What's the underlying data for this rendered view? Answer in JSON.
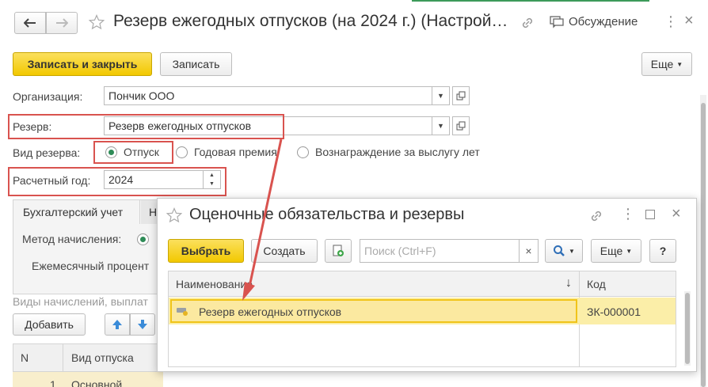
{
  "header": {
    "title": "Резерв ежегодных отпусков (на 2024 г.) (Настрой…",
    "discussion_label": "Обсуждение"
  },
  "toolbar": {
    "save_close_label": "Записать и закрыть",
    "save_label": "Записать",
    "more_label": "Еще"
  },
  "form": {
    "organization_label": "Организация:",
    "organization_value": "Пончик ООО",
    "reserve_label": "Резерв:",
    "reserve_value": "Резерв ежегодных отпусков",
    "reserve_type_label": "Вид резерва:",
    "reserve_type_options": [
      "Отпуск",
      "Годовая премия",
      "Вознаграждение за выслугу лет"
    ],
    "year_label": "Расчетный год:",
    "year_value": "2024"
  },
  "tabs": {
    "accounting": "Бухгалтерский учет",
    "second_partial": "Н"
  },
  "accounting": {
    "method_label": "Метод начисления:",
    "monthly_percent_label": "Ежемесячный процент",
    "accruals_label": "Виды начислений, выплат",
    "add_label": "Добавить"
  },
  "table": {
    "col_n": "N",
    "col_vacation": "Вид отпуска",
    "row_n": "1",
    "row_vacation": "Основной"
  },
  "dialog": {
    "title": "Оценочные обязательства и резервы",
    "select_label": "Выбрать",
    "create_label": "Создать",
    "search_placeholder": "Поиск (Ctrl+F)",
    "more_label": "Еще",
    "help_label": "?",
    "col_name": "Наименование",
    "col_code": "Код",
    "sort_arrow": "↓",
    "row_name": "Резерв ежегодных отпусков",
    "row_code": "ЗК-000001"
  }
}
